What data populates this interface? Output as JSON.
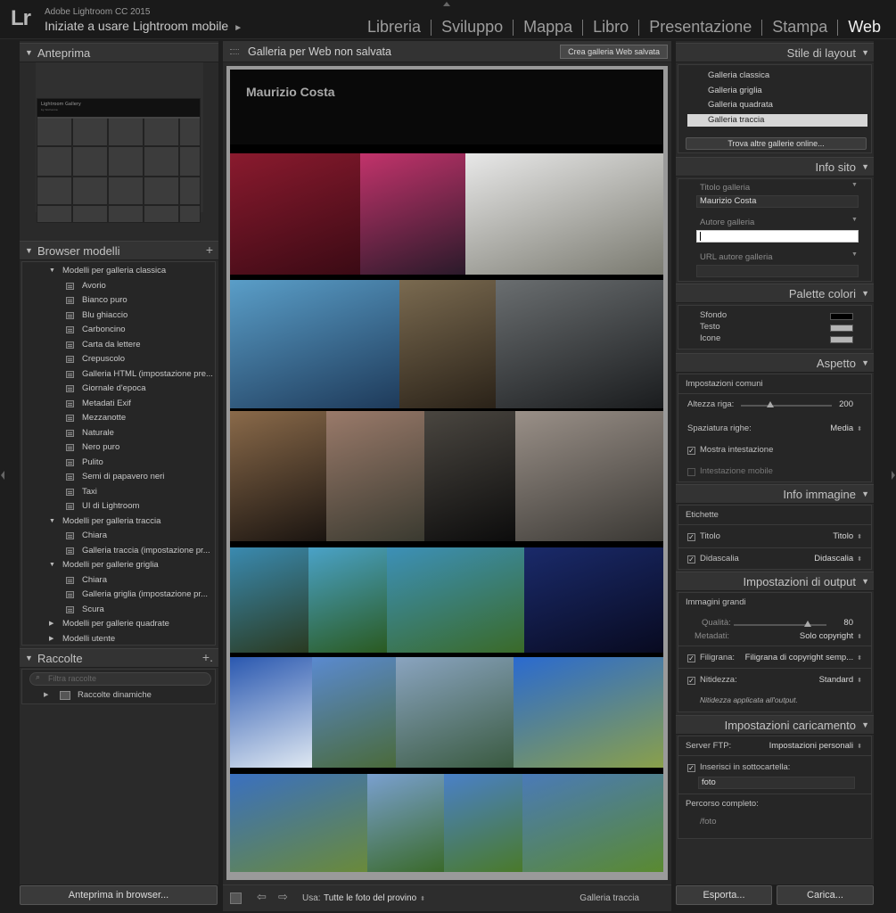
{
  "app": {
    "logo": "Lr",
    "title": "Adobe Lightroom CC 2015",
    "subtitle": "Iniziate a usare Lightroom mobile",
    "subtitle_arrow": "►"
  },
  "modules": [
    {
      "label": "Libreria",
      "active": false
    },
    {
      "label": "Sviluppo",
      "active": false
    },
    {
      "label": "Mappa",
      "active": false
    },
    {
      "label": "Libro",
      "active": false
    },
    {
      "label": "Presentazione",
      "active": false
    },
    {
      "label": "Stampa",
      "active": false
    },
    {
      "label": "Web",
      "active": true
    }
  ],
  "left": {
    "preview_title": "Anteprima",
    "preview_caption": "Lightroom Gallery",
    "preview_caption_sub": "by Someone",
    "browser_title": "Browser modelli",
    "browser_plus": "+",
    "tree": [
      {
        "type": "folder",
        "label": "Modelli per galleria classica",
        "open": true
      },
      {
        "type": "item",
        "label": "Avorio"
      },
      {
        "type": "item",
        "label": "Bianco puro"
      },
      {
        "type": "item",
        "label": "Blu ghiaccio"
      },
      {
        "type": "item",
        "label": "Carboncino"
      },
      {
        "type": "item",
        "label": "Carta da lettere"
      },
      {
        "type": "item",
        "label": "Crepuscolo"
      },
      {
        "type": "item",
        "label": "Galleria HTML (impostazione pre..."
      },
      {
        "type": "item",
        "label": "Giornale d'epoca"
      },
      {
        "type": "item",
        "label": "Metadati Exif"
      },
      {
        "type": "item",
        "label": "Mezzanotte"
      },
      {
        "type": "item",
        "label": "Naturale"
      },
      {
        "type": "item",
        "label": "Nero puro"
      },
      {
        "type": "item",
        "label": "Pulito"
      },
      {
        "type": "item",
        "label": "Semi di papavero neri"
      },
      {
        "type": "item",
        "label": "Taxi"
      },
      {
        "type": "item",
        "label": "UI di Lightroom"
      },
      {
        "type": "folder",
        "label": "Modelli per galleria traccia",
        "open": true
      },
      {
        "type": "item",
        "label": "Chiara"
      },
      {
        "type": "item",
        "label": "Galleria traccia (impostazione pr..."
      },
      {
        "type": "folder",
        "label": "Modelli per gallerie griglia",
        "open": true
      },
      {
        "type": "item",
        "label": "Chiara"
      },
      {
        "type": "item",
        "label": "Galleria griglia (impostazione pr..."
      },
      {
        "type": "item",
        "label": "Scura"
      },
      {
        "type": "folder",
        "label": "Modelli per gallerie quadrate",
        "open": false
      },
      {
        "type": "folder",
        "label": "Modelli utente",
        "open": false
      }
    ],
    "collections_title": "Raccolte",
    "collections_plus": "+.",
    "filter_placeholder": "Filtra raccolte",
    "smart_collections": "Raccolte dinamiche",
    "preview_button": "Anteprima in browser..."
  },
  "center": {
    "title": "Galleria per Web non salvata",
    "save_button": "Crea galleria Web salvata",
    "gallery_name": "Maurizio Costa",
    "photos": [
      {
        "name": "photo-red-leaves",
        "c1": "#8a1a2e",
        "c2": "#3a0a14"
      },
      {
        "name": "photo-nun-and-man",
        "c1": "#c2336b",
        "c2": "#2a1a2a"
      },
      {
        "name": "photo-sandwich",
        "c1": "#e8e8e8",
        "c2": "#7a7a70"
      },
      {
        "name": "photo-damselfly",
        "c1": "#5a9ec8",
        "c2": "#1e3a5a"
      },
      {
        "name": "photo-columns",
        "c1": "#7a6a50",
        "c2": "#2a2218"
      },
      {
        "name": "photo-control-panel",
        "c1": "#6a6e70",
        "c2": "#1a1c1e"
      },
      {
        "name": "photo-tunnel-lights",
        "c1": "#8a6a4a",
        "c2": "#1a1410"
      },
      {
        "name": "photo-houses-street",
        "c1": "#9a7a6a",
        "c2": "#3a3a30"
      },
      {
        "name": "photo-dark-water",
        "c1": "#4a4640",
        "c2": "#0c0c0c"
      },
      {
        "name": "photo-robot-toy",
        "c1": "#9a9088",
        "c2": "#3a3834"
      },
      {
        "name": "photo-sea-cliff",
        "c1": "#3a8ab0",
        "c2": "#2a3a20"
      },
      {
        "name": "photo-tree-sea-1",
        "c1": "#4aa2c8",
        "c2": "#2a5a20"
      },
      {
        "name": "photo-tree-sea-2",
        "c1": "#3c90b8",
        "c2": "#3a6a28"
      },
      {
        "name": "photo-night-sky",
        "c1": "#1a2a6a",
        "c2": "#080a20"
      },
      {
        "name": "photo-blue-sky-clouds",
        "c1": "#2a58b0",
        "c2": "#dfe8f2"
      },
      {
        "name": "photo-clouds-field",
        "c1": "#5a8ad0",
        "c2": "#4a6a3a"
      },
      {
        "name": "photo-mountain-lake",
        "c1": "#8aa4c0",
        "c2": "#3a5a40"
      },
      {
        "name": "photo-clouds-meadow",
        "c1": "#2a6ad0",
        "c2": "#8aa04a"
      },
      {
        "name": "photo-dirt-road",
        "c1": "#3a70c0",
        "c2": "#6a8a3a"
      },
      {
        "name": "photo-alps-1",
        "c1": "#7aa0d0",
        "c2": "#3a6a2a"
      },
      {
        "name": "photo-alps-2",
        "c1": "#4a80c8",
        "c2": "#4a7a2a"
      },
      {
        "name": "photo-alps-valley",
        "c1": "#4a7ab8",
        "c2": "#5a8a30"
      }
    ],
    "toolbar": {
      "use_label": "Usa:",
      "use_value": "Tutte le foto del provino",
      "gallery_type": "Galleria traccia"
    }
  },
  "right": {
    "layout_style": {
      "title": "Stile di layout",
      "items": [
        {
          "label": "Galleria classica",
          "selected": false
        },
        {
          "label": "Galleria griglia",
          "selected": false
        },
        {
          "label": "Galleria quadrata",
          "selected": false
        },
        {
          "label": "Galleria traccia",
          "selected": true
        }
      ],
      "more_button": "Trova altre gallerie online..."
    },
    "site_info": {
      "title": "Info sito",
      "gallery_title_label": "Titolo galleria",
      "gallery_title_value": "Maurizio Costa",
      "gallery_author_label": "Autore galleria",
      "gallery_author_value": "",
      "author_url_label": "URL autore galleria",
      "author_url_value": ""
    },
    "palette": {
      "title": "Palette colori",
      "items": [
        {
          "label": "Sfondo",
          "color": "#000000"
        },
        {
          "label": "Testo",
          "color": "#b5b5b5"
        },
        {
          "label": "Icone",
          "color": "#b5b5b5"
        }
      ]
    },
    "appearance": {
      "title": "Aspetto",
      "common": "Impostazioni comuni",
      "row_height_label": "Altezza riga:",
      "row_height_value": "200",
      "row_height_fraction": 0.32,
      "row_spacing_label": "Spaziatura righe:",
      "row_spacing_value": "Media",
      "show_header_label": "Mostra intestazione",
      "show_header_checked": true,
      "mobile_header_label": "Intestazione mobile",
      "mobile_header_checked": false
    },
    "image_info": {
      "title": "Info immagine",
      "labels": "Etichette",
      "title_label": "Titolo",
      "title_value": "Titolo",
      "caption_label": "Didascalia",
      "caption_value": "Didascalia"
    },
    "output": {
      "title": "Impostazioni di output",
      "large_images": "Immagini grandi",
      "quality_label": "Qualità:",
      "quality_value": "80",
      "quality_fraction": 0.8,
      "metadata_label": "Metadati:",
      "metadata_value": "Solo copyright",
      "watermark_label": "Filigrana:",
      "watermark_value": "Filigrana di copyright semp...",
      "sharpen_label": "Nitidezza:",
      "sharpen_value": "Standard",
      "sharpen_note": "Nitidezza applicata all'output."
    },
    "upload": {
      "title": "Impostazioni caricamento",
      "ftp_label": "Server FTP:",
      "ftp_value": "Impostazioni personali",
      "subfolder_label": "Inserisci in sottocartella:",
      "subfolder_value": "foto",
      "fullpath_label": "Percorso completo:",
      "fullpath_value": "/foto"
    },
    "export_button": "Esporta...",
    "upload_button": "Carica..."
  }
}
